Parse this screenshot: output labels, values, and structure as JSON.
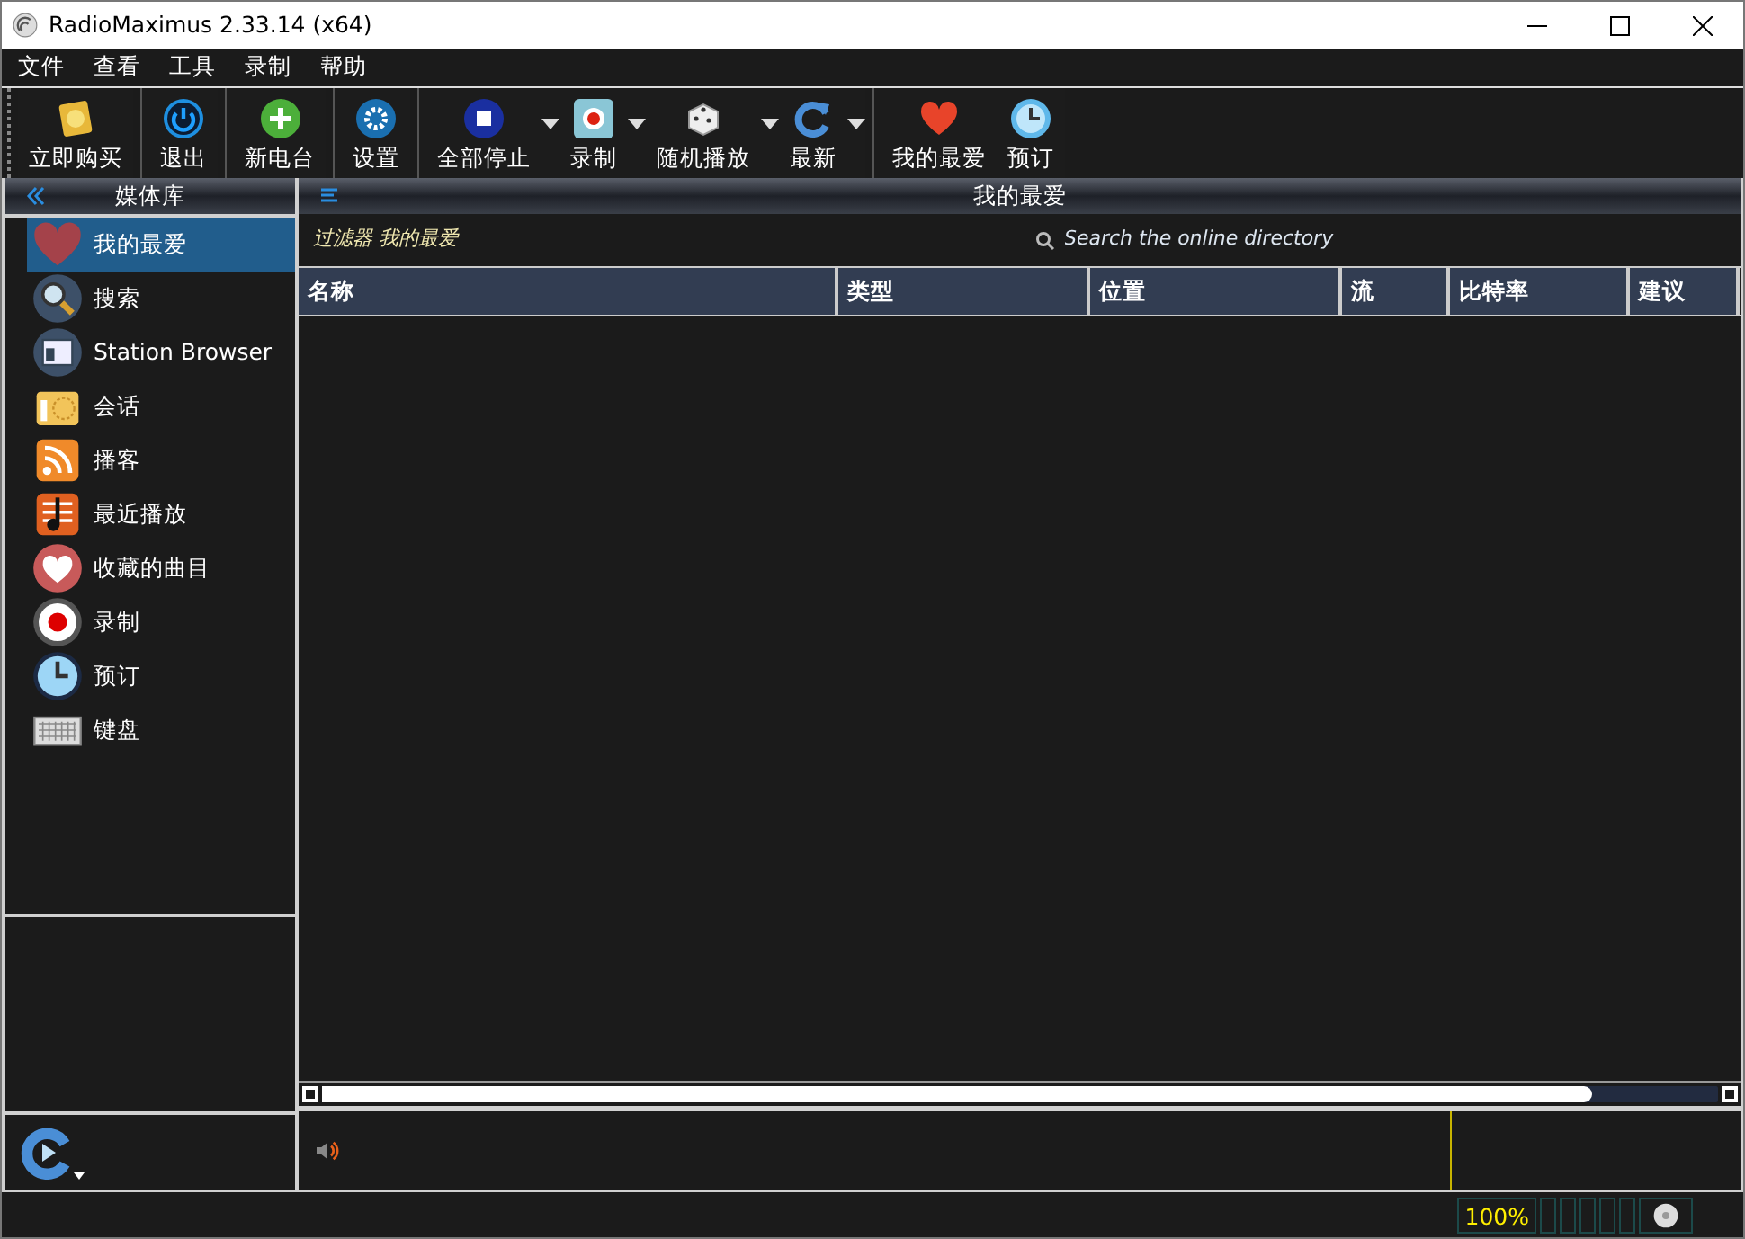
{
  "window": {
    "title": "RadioMaximus 2.33.14 (x64)"
  },
  "menu": [
    "文件",
    "查看",
    "工具",
    "录制",
    "帮助"
  ],
  "toolbar": [
    {
      "label": "立即购买",
      "has_menu": false,
      "separator_before": false
    },
    {
      "label": "退出",
      "has_menu": false,
      "separator_before": true
    },
    {
      "label": "新电台",
      "has_menu": false,
      "separator_before": true
    },
    {
      "label": "设置",
      "has_menu": false,
      "separator_before": true
    },
    {
      "label": "全部停止",
      "has_menu": true,
      "separator_before": true
    },
    {
      "label": "录制",
      "has_menu": true,
      "separator_before": false
    },
    {
      "label": "随机播放",
      "has_menu": true,
      "separator_before": false
    },
    {
      "label": "最新",
      "has_menu": true,
      "separator_before": false
    },
    {
      "label": "我的最爱",
      "has_menu": false,
      "separator_before": true
    },
    {
      "label": "预订",
      "has_menu": false,
      "separator_before": false
    }
  ],
  "sidebar": {
    "title": "媒体库",
    "items": [
      {
        "label": "我的最爱",
        "selected": true
      },
      {
        "label": "搜索",
        "selected": false
      },
      {
        "label": "Station Browser",
        "selected": false
      },
      {
        "label": "会话",
        "selected": false
      },
      {
        "label": "播客",
        "selected": false
      },
      {
        "label": "最近播放",
        "selected": false
      },
      {
        "label": "收藏的曲目",
        "selected": false
      },
      {
        "label": "录制",
        "selected": false
      },
      {
        "label": "预订",
        "selected": false
      },
      {
        "label": "键盘",
        "selected": false
      }
    ]
  },
  "panel": {
    "title": "我的最爱",
    "filter": "过滤器 我的最爱",
    "search": {
      "placeholder": "Search the online directory"
    },
    "table": {
      "columns": [
        "名称",
        "类型",
        "位置",
        "流",
        "比特率",
        "建议"
      ]
    }
  },
  "status_bar": {
    "volume": "100%"
  }
}
